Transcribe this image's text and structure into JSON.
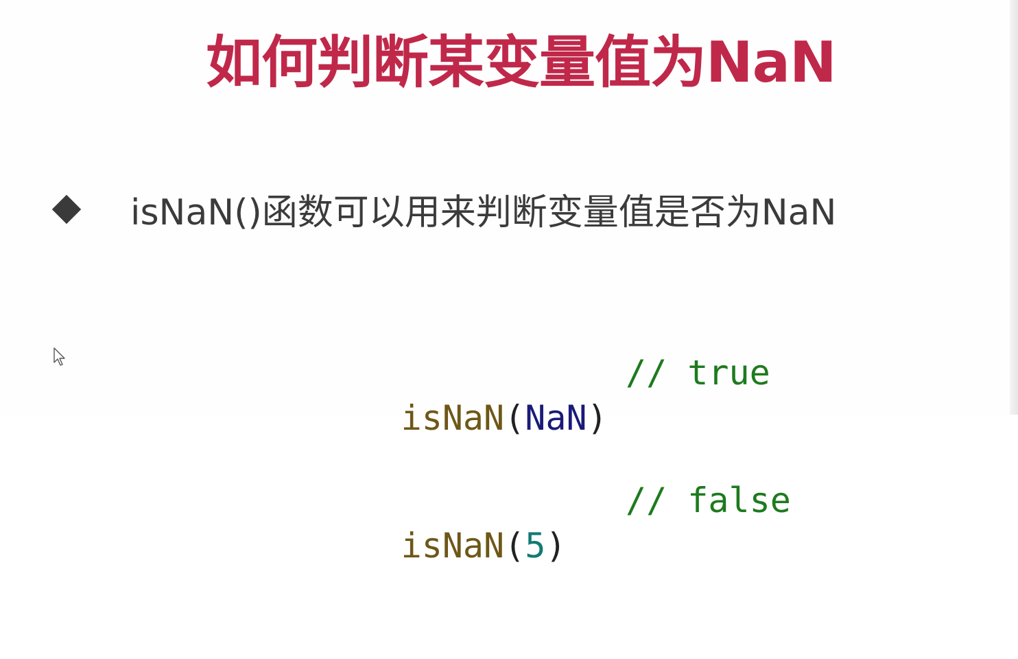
{
  "slide": {
    "title": "如何判断某变量值为NaN",
    "bullet": {
      "text": "isNaN()函数可以用来判断变量值是否为NaN",
      "marker_icon": "diamond-bullet-icon"
    },
    "code": [
      {
        "fn": "isNaN",
        "open": "(",
        "arg": "NaN",
        "close": ")",
        "comment": "// true"
      },
      {
        "fn": "isNaN",
        "open": "(",
        "arg": "5",
        "close": ")",
        "comment": "// false"
      }
    ]
  },
  "colors": {
    "title": "#c0284a",
    "text": "#3b3b3b",
    "code_function": "#6e5717",
    "code_keyword": "#1a1a7a",
    "code_number": "#127a74",
    "code_comment": "#1e7a1e"
  },
  "cursor_icon": "mouse-pointer-icon"
}
